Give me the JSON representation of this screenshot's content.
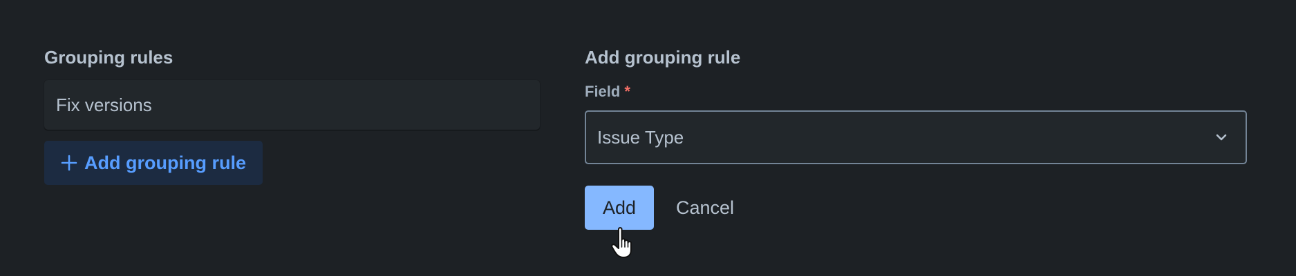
{
  "grouping_rules": {
    "title": "Grouping rules",
    "rules": [
      "Fix versions"
    ],
    "add_button_label": "Add grouping rule"
  },
  "add_rule_form": {
    "title": "Add grouping rule",
    "field_label": "Field",
    "required_marker": "*",
    "field_value": "Issue Type",
    "submit_label": "Add",
    "cancel_label": "Cancel"
  },
  "icons": {
    "add": "plus-icon",
    "dropdown": "chevron-down-icon",
    "cursor": "hand-pointer-icon"
  },
  "colors": {
    "background": "#1d2125",
    "accent": "#579dff",
    "primary_button": "#85b8ff",
    "required": "#f87168"
  }
}
